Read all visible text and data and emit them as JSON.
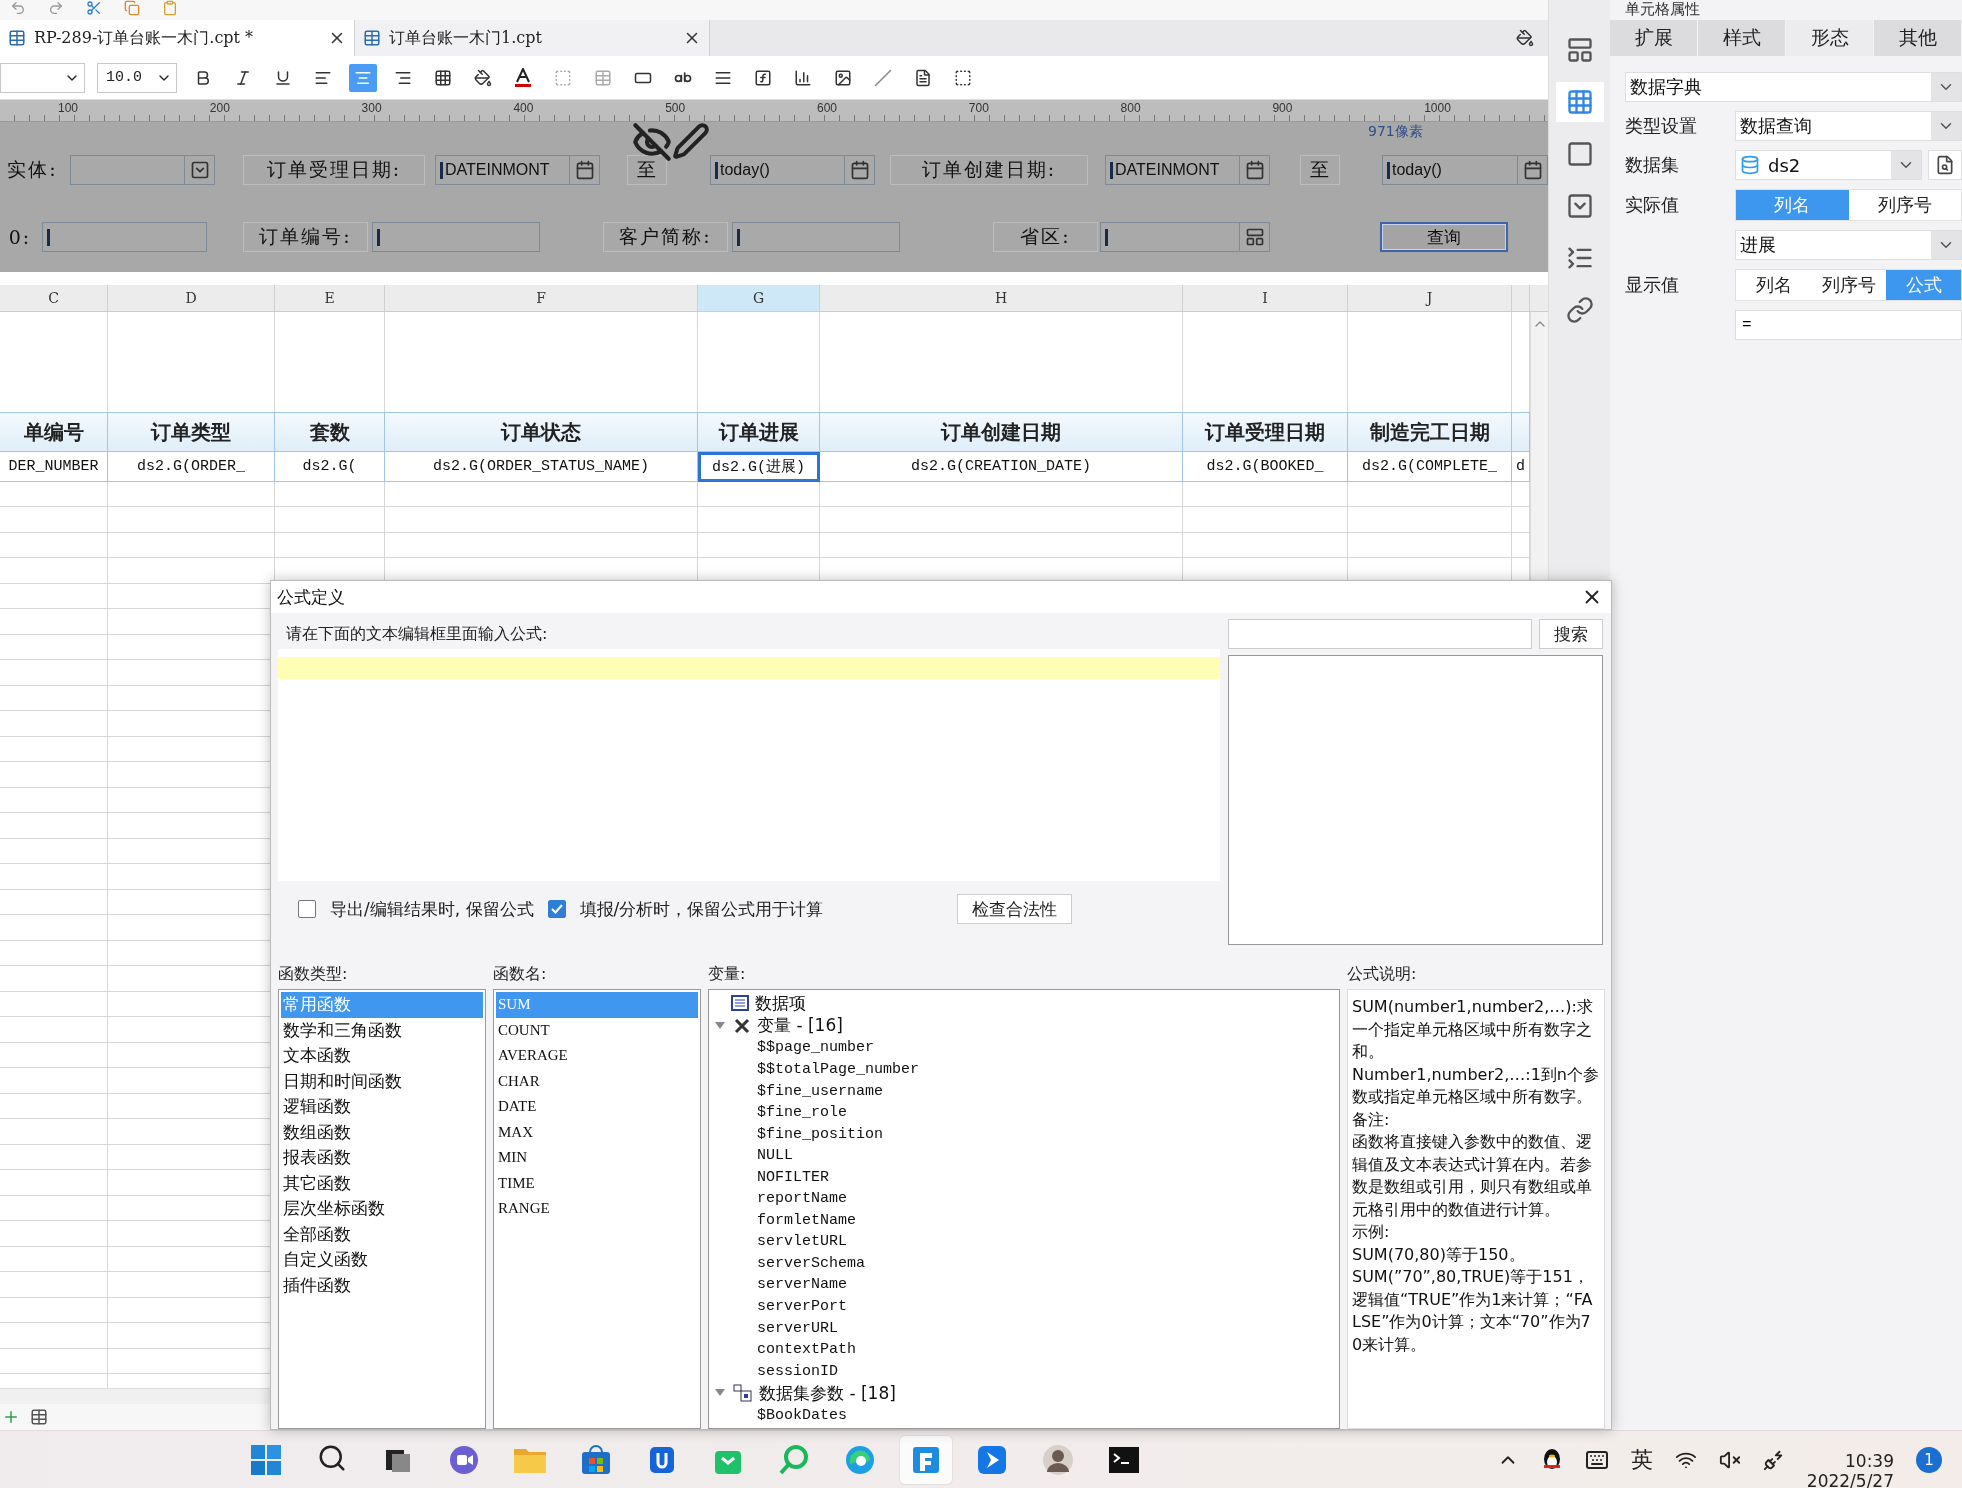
{
  "file_tabs": [
    {
      "label": "RP-289-订单台账一木门.cpt *",
      "selected": true
    },
    {
      "label": "订单台账一木门1.cpt",
      "selected": false
    }
  ],
  "format_toolbar": {
    "font_size": "10.0",
    "alignment": [
      {
        "kind": "left",
        "selected": false
      },
      {
        "kind": "center",
        "selected": true
      },
      {
        "kind": "right",
        "selected": false
      }
    ]
  },
  "ruler": {
    "ticks": [
      "100",
      "200",
      "300",
      "400",
      "500",
      "600",
      "700",
      "800",
      "900",
      "1000"
    ],
    "note": "971像素"
  },
  "parameter_panel": {
    "rows": [
      [
        {
          "kind": "label",
          "text": "实体:",
          "framed": false
        },
        {
          "kind": "combo"
        },
        {
          "kind": "label",
          "text": "订单受理日期:",
          "framed": true
        },
        {
          "kind": "date",
          "value": "DATEINMONT"
        },
        {
          "kind": "label",
          "text": "至",
          "framed": true
        },
        {
          "kind": "date",
          "value": "today()"
        },
        {
          "kind": "label",
          "text": "订单创建日期:",
          "framed": true
        },
        {
          "kind": "date",
          "value": "DATEINMONT"
        },
        {
          "kind": "label",
          "text": "至",
          "framed": true
        },
        {
          "kind": "date",
          "value": "today()"
        }
      ],
      [
        {
          "kind": "label",
          "text": "0:",
          "framed": false
        },
        {
          "kind": "text"
        },
        {
          "kind": "label",
          "text": "订单编号:",
          "framed": true
        },
        {
          "kind": "text"
        },
        {
          "kind": "label",
          "text": "客户简称:",
          "framed": true
        },
        {
          "kind": "text"
        },
        {
          "kind": "label",
          "text": "省区:",
          "framed": true
        },
        {
          "kind": "tree"
        },
        {
          "kind": "button",
          "text": "查询",
          "selected": true
        }
      ]
    ]
  },
  "sheet": {
    "columns": [
      {
        "label": "C",
        "selected": false
      },
      {
        "label": "D",
        "selected": false
      },
      {
        "label": "E",
        "selected": false
      },
      {
        "label": "F",
        "selected": false
      },
      {
        "label": "G",
        "selected": true
      },
      {
        "label": "H",
        "selected": false
      },
      {
        "label": "I",
        "selected": false
      },
      {
        "label": "J",
        "selected": false
      }
    ],
    "header_row": [
      "单编号",
      "订单类型",
      "套数",
      "订单状态",
      "订单进展",
      "订单创建日期",
      "订单受理日期",
      "制造完工日期"
    ],
    "data_row": [
      {
        "text": "DER_NUMBER",
        "selected": false
      },
      {
        "text": "ds2.G(ORDER_",
        "selected": false
      },
      {
        "text": "ds2.G(",
        "selected": false
      },
      {
        "text": "ds2.G(ORDER_STATUS_NAME)",
        "selected": false
      },
      {
        "text": "ds2.G(进展)",
        "selected": true
      },
      {
        "text": "ds2.G(CREATION_DATE)",
        "selected": false
      },
      {
        "text": "ds2.G(BOOKED_",
        "selected": false
      },
      {
        "text": "ds2.G(COMPLETE_",
        "selected": false
      },
      {
        "text": "d",
        "selected": false
      }
    ]
  },
  "side_tools": [
    {
      "kind": "layout",
      "selected": false
    },
    {
      "kind": "widget",
      "selected": true
    },
    {
      "kind": "frame",
      "selected": false
    },
    {
      "kind": "combo",
      "selected": false
    },
    {
      "kind": "list",
      "selected": false
    },
    {
      "kind": "link",
      "selected": false
    }
  ],
  "properties": {
    "title": "单元格属性",
    "tabs": [
      {
        "label": "扩展",
        "selected": false
      },
      {
        "label": "样式",
        "selected": false
      },
      {
        "label": "形态",
        "selected": true
      },
      {
        "label": "其他",
        "selected": false
      }
    ],
    "dictionary": "数据字典",
    "type_label": "类型设置",
    "type_value": "数据查询",
    "dataset_label": "数据集",
    "dataset_value": "ds2",
    "actual_label": "实际值",
    "actual_options": [
      {
        "label": "列名",
        "selected": true
      },
      {
        "label": "列序号",
        "selected": false
      }
    ],
    "actual_column": "进展",
    "display_label": "显示值",
    "display_options": [
      {
        "label": "列名",
        "selected": false
      },
      {
        "label": "列序号",
        "selected": false
      },
      {
        "label": "公式",
        "selected": true
      }
    ],
    "formula": "="
  },
  "dialog": {
    "title": "公式定义",
    "prompt": "请在下面的文本编辑框里面输入公式:",
    "search_button": "搜索",
    "options": [
      {
        "label": "导出/编辑结果时, 保留公式",
        "checked": false
      },
      {
        "label": "填报/分析时，保留公式用于计算",
        "checked": true
      }
    ],
    "check_button": "检查合法性",
    "function_types_label": "函数类型:",
    "function_types": [
      {
        "label": "常用函数",
        "selected": true
      },
      {
        "label": "数学和三角函数",
        "selected": false
      },
      {
        "label": "文本函数",
        "selected": false
      },
      {
        "label": "日期和时间函数",
        "selected": false
      },
      {
        "label": "逻辑函数",
        "selected": false
      },
      {
        "label": "数组函数",
        "selected": false
      },
      {
        "label": "报表函数",
        "selected": false
      },
      {
        "label": "其它函数",
        "selected": false
      },
      {
        "label": "层次坐标函数",
        "selected": false
      },
      {
        "label": "全部函数",
        "selected": false
      },
      {
        "label": "自定义函数",
        "selected": false
      },
      {
        "label": "插件函数",
        "selected": false
      }
    ],
    "function_names_label": "函数名:",
    "function_names": [
      {
        "label": "SUM",
        "selected": true
      },
      {
        "label": "COUNT",
        "selected": false
      },
      {
        "label": "AVERAGE",
        "selected": false
      },
      {
        "label": "CHAR",
        "selected": false
      },
      {
        "label": "DATE",
        "selected": false
      },
      {
        "label": "MAX",
        "selected": false
      },
      {
        "label": "MIN",
        "selected": false
      },
      {
        "label": "TIME",
        "selected": false
      },
      {
        "label": "RANGE",
        "selected": false
      }
    ],
    "variables_label": "变量:",
    "variables": [
      {
        "kind": "data",
        "label": "数据项"
      },
      {
        "kind": "vars",
        "label": "变量 - [16]",
        "expanded": true,
        "children": [
          {
            "label": "$$page_number"
          },
          {
            "label": "$$totalPage_number"
          },
          {
            "label": "$fine_username"
          },
          {
            "label": "$fine_role"
          },
          {
            "label": "$fine_position"
          },
          {
            "label": "NULL"
          },
          {
            "label": "NOFILTER"
          },
          {
            "label": "reportName"
          },
          {
            "label": "formletName"
          },
          {
            "label": "servletURL"
          },
          {
            "label": "serverSchema"
          },
          {
            "label": "serverName"
          },
          {
            "label": "serverPort"
          },
          {
            "label": "serverURL"
          },
          {
            "label": "contextPath"
          },
          {
            "label": "sessionID"
          }
        ]
      },
      {
        "kind": "params",
        "label": "数据集参数 - [18]",
        "expanded": true,
        "children": [
          {
            "label": "$BookDates"
          }
        ]
      }
    ],
    "description_label": "公式说明:",
    "description": [
      "SUM(number1,number2,…):求一个指定单元格区域中所有数字之和。",
      "Number1,number2,…:1到n个参数或指定单元格区域中所有数字。",
      "备注:",
      "函数将直接键入参数中的数值、逻辑值及文本表达式计算在内。若参数是数组或引用，则只有数组或单元格引用中的数值进行计算。",
      "示例:",
      "SUM(70,80)等于150。",
      "SUM(”70”,80,TRUE)等于151，逻辑值“TRUE”作为1来计算；“FALSE”作为0计算；文本“70”作为70来计算。"
    ]
  },
  "taskbar": {
    "apps": [
      {
        "kind": "start",
        "active": false
      },
      {
        "kind": "search",
        "active": false
      },
      {
        "kind": "taskview",
        "active": false
      },
      {
        "kind": "chat",
        "active": false
      },
      {
        "kind": "folder",
        "active": false
      },
      {
        "kind": "store",
        "active": false
      },
      {
        "kind": "bluedoc",
        "active": false
      },
      {
        "kind": "greenbag",
        "active": false
      },
      {
        "kind": "greensearch",
        "active": false
      },
      {
        "kind": "browser",
        "active": false
      },
      {
        "kind": "designer",
        "active": true
      },
      {
        "kind": "bluearrow",
        "active": false
      },
      {
        "kind": "person",
        "active": false
      },
      {
        "kind": "terminal",
        "active": false
      }
    ],
    "ime": "英",
    "time": "10:39",
    "date": "2022/5/27",
    "badge": "1"
  }
}
